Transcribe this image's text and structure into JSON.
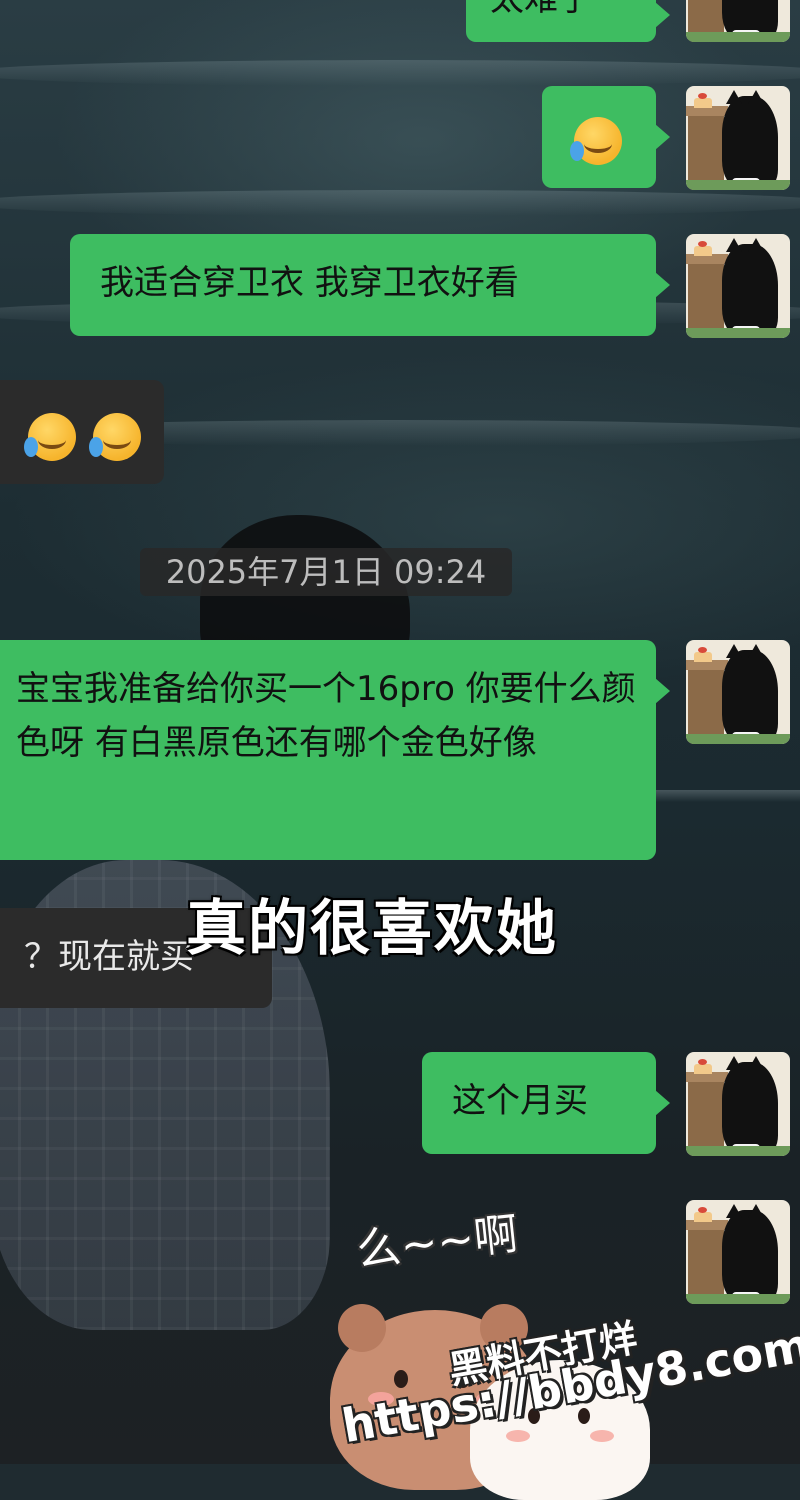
{
  "messages": [
    {
      "id": "m0",
      "side": "me",
      "text": "太难了"
    },
    {
      "id": "m1",
      "side": "me",
      "emoji": [
        "face-with-tears-of-joy-emoji"
      ]
    },
    {
      "id": "m2",
      "side": "me",
      "text": "我适合穿卫衣 我穿卫衣好看"
    },
    {
      "id": "m3",
      "side": "them",
      "emoji": [
        "face-with-tears-of-joy-emoji",
        "face-with-tears-of-joy-emoji"
      ]
    },
    {
      "id": "m4",
      "side": "me",
      "text": "宝宝我准备给你买一个16pro 你要什么颜色呀 有白黑原色还有哪个金色好像"
    },
    {
      "id": "m5",
      "side": "them",
      "text": "？现在就买"
    },
    {
      "id": "m6",
      "side": "me",
      "text": "这个月买"
    }
  ],
  "timestamp": "2025年7月1日 09:24",
  "overlay_caption": "真的很喜欢她",
  "sticker": {
    "text": "么~~啊",
    "characters": [
      "bear-sticker",
      "bunny-sticker"
    ]
  },
  "watermark": {
    "line1": "黑料不打烊",
    "line2": "https://bbdy8.com"
  },
  "colors": {
    "my_bubble": "#3ebd61",
    "their_bubble": "#2b2b2b",
    "timestamp_bg": "#282828"
  }
}
